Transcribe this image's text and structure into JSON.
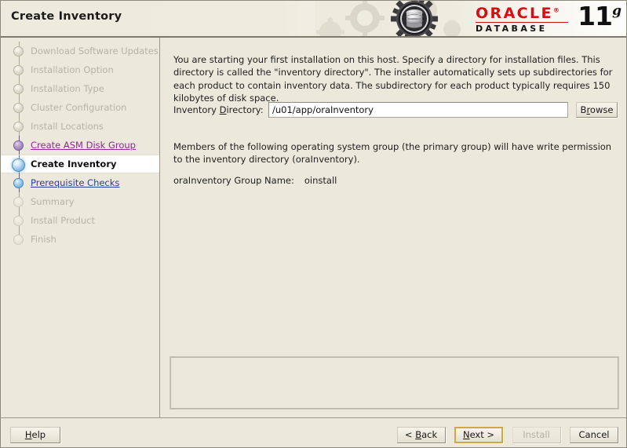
{
  "window": {
    "title": "Create Inventory"
  },
  "branding": {
    "oracle_word": "ORACLE",
    "registered_mark": "®",
    "product_line": "DATABASE",
    "version_number": "11",
    "version_suffix": "g"
  },
  "sidebar": {
    "steps": [
      {
        "label": "Download Software Updates",
        "state": "done"
      },
      {
        "label": "Installation Option",
        "state": "done"
      },
      {
        "label": "Installation Type",
        "state": "done"
      },
      {
        "label": "Cluster Configuration",
        "state": "done"
      },
      {
        "label": "Install Locations",
        "state": "done"
      },
      {
        "label": "Create ASM Disk Group",
        "state": "asm"
      },
      {
        "label": "Create Inventory",
        "state": "current"
      },
      {
        "label": "Prerequisite Checks",
        "state": "link"
      },
      {
        "label": "Summary",
        "state": "future"
      },
      {
        "label": "Install Product",
        "state": "future"
      },
      {
        "label": "Finish",
        "state": "future"
      }
    ]
  },
  "main": {
    "intro_text": "You are starting your first installation on this host. Specify a directory for installation files. This directory is called the \"inventory directory\". The installer automatically sets up subdirectories for each product to contain inventory data. The subdirectory for each product typically requires 150 kilobytes of disk space.",
    "inventory_directory": {
      "label_prefix": "Inventory ",
      "label_mnemonic": "D",
      "label_suffix": "irectory:",
      "value": "/u01/app/oraInventory",
      "placeholder": "/u01/app/oraInventory"
    },
    "browse_button": {
      "prefix": "B",
      "mnemonic": "r",
      "suffix": "owse"
    },
    "permission_text": "Members of the following operating system group (the primary group) will have write permission to the inventory directory (oraInventory).",
    "group_name": {
      "label": "oraInventory Group Name:",
      "value": "oinstall"
    },
    "message_panel_text": ""
  },
  "footer": {
    "help": {
      "mnemonic": "H",
      "suffix": "elp"
    },
    "back": {
      "prefix": "< ",
      "mnemonic": "B",
      "suffix": "ack"
    },
    "next": {
      "mnemonic": "N",
      "suffix": "ext >"
    },
    "install": {
      "label": "Install",
      "enabled": false
    },
    "cancel": {
      "label": "Cancel"
    }
  },
  "colors": {
    "background": "#ece9dc",
    "oracle_red": "#d40f14",
    "visited_link": "#8e2a8e",
    "link": "#2a3f93",
    "focus_border": "#d4a73e"
  }
}
